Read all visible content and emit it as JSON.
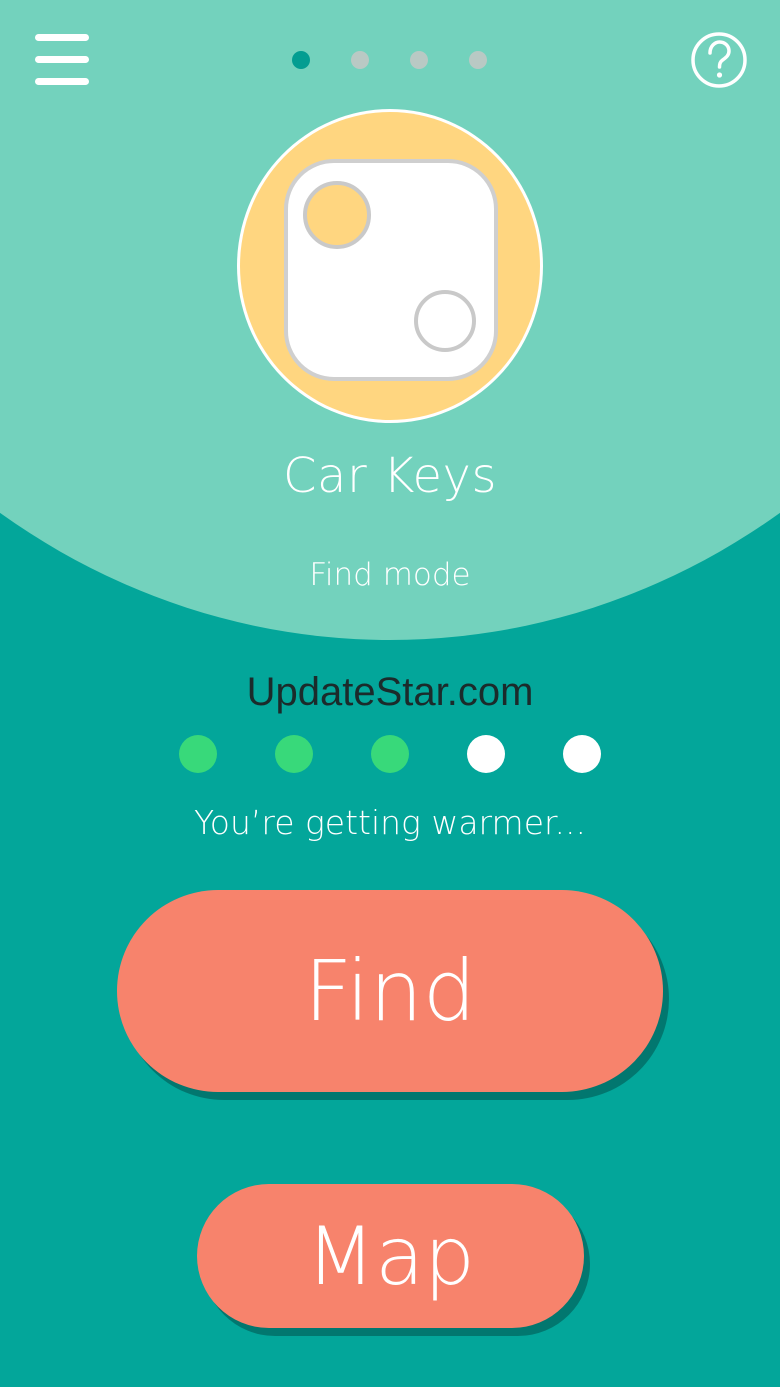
{
  "header": {
    "menu_icon": "hamburger-menu-icon",
    "help_icon": "question-mark-icon",
    "page_indicator": {
      "count": 4,
      "active_index": 0
    }
  },
  "device": {
    "name": "Car Keys",
    "mode": "Find mode",
    "icon": "tracker-tag-icon"
  },
  "watermark": "UpdateStar.com",
  "signal": {
    "total": 5,
    "filled": 3,
    "hint": "You’re getting warmer..."
  },
  "buttons": {
    "find_label": "Find",
    "map_label": "Map"
  },
  "colors": {
    "top_background": "#73d2bd",
    "bottom_background": "#03a69a",
    "device_circle": "#ffd680",
    "button": "#f7836c",
    "signal_on": "#38d97a",
    "page_dot_active": "#039d91",
    "page_dot_inactive": "#b9c9c4"
  }
}
